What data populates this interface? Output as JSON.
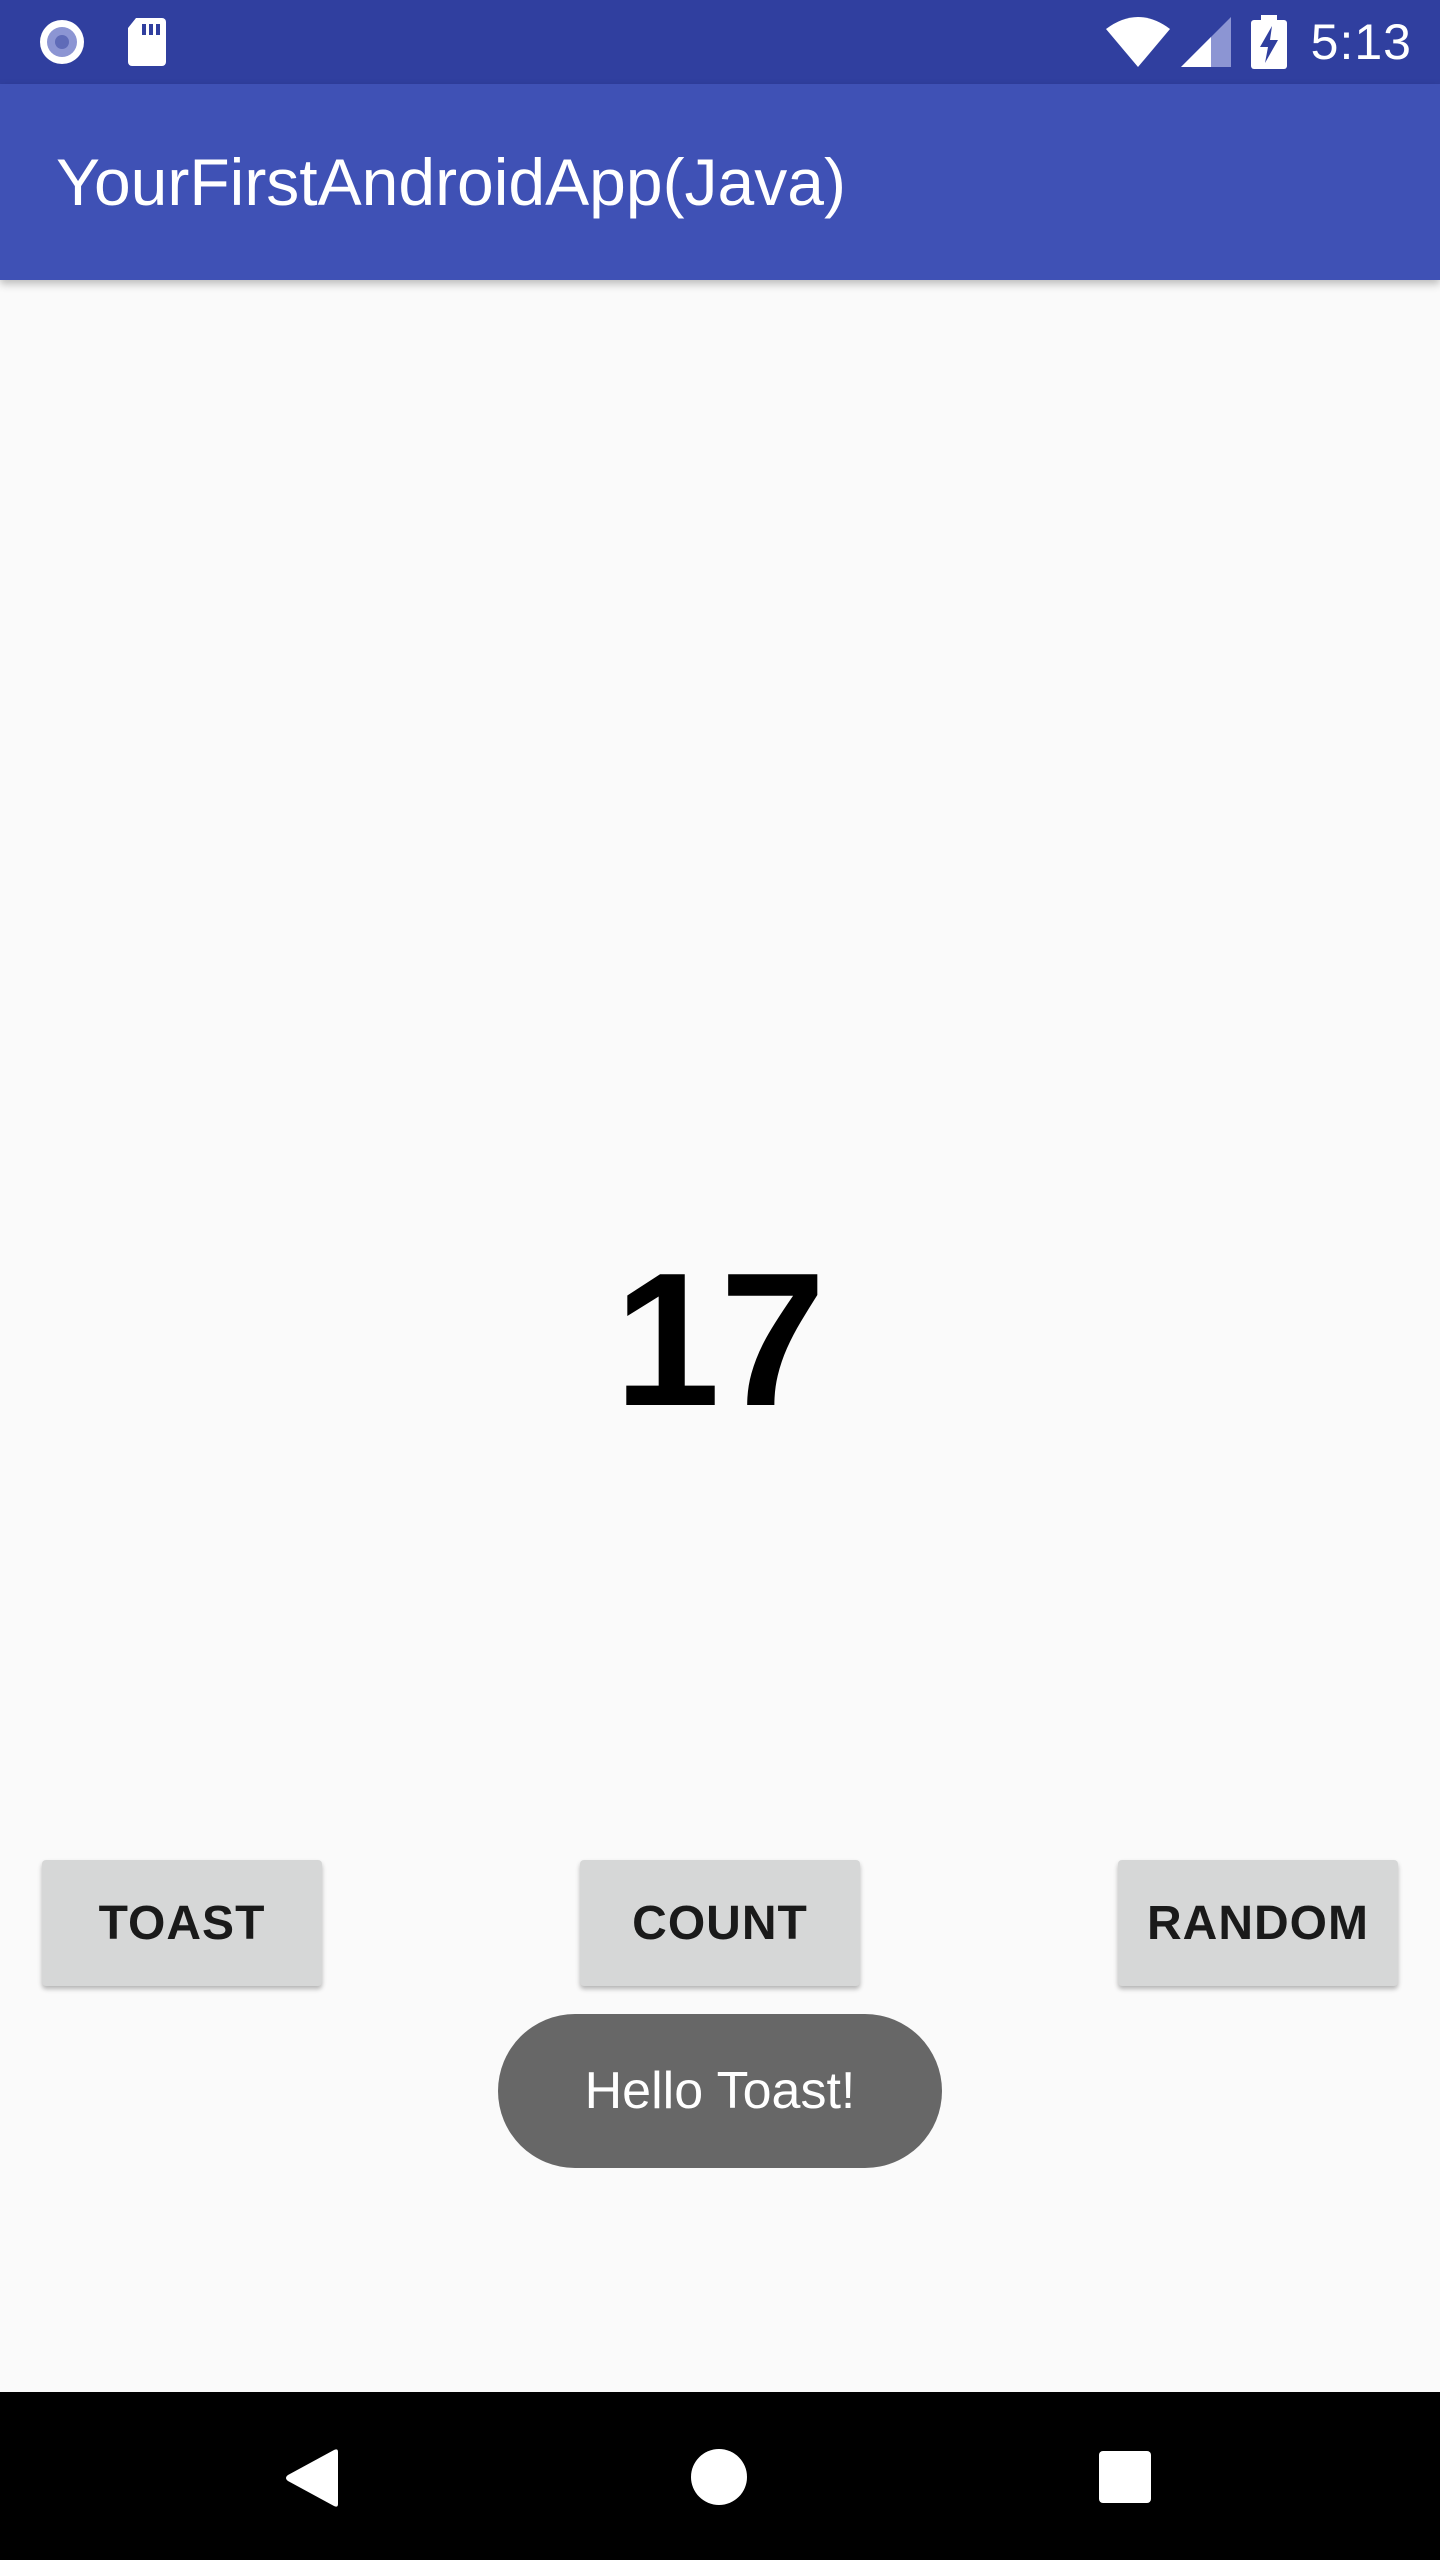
{
  "status_bar": {
    "time": "5:13",
    "left_icons": [
      "record-icon",
      "sd-card-icon"
    ],
    "right_icons": [
      "wifi-icon",
      "cell-signal-icon",
      "battery-charging-icon"
    ],
    "background": "#303f9f"
  },
  "app_bar": {
    "title": "YourFirstAndroidApp(Java)",
    "background": "#3f51b5"
  },
  "main": {
    "count": "17"
  },
  "buttons": {
    "toast_label": "TOAST",
    "count_label": "COUNT",
    "random_label": "RANDOM"
  },
  "toast": {
    "message": "Hello Toast!"
  },
  "nav_bar": {
    "icons": [
      "back-icon",
      "home-icon",
      "recents-icon"
    ]
  }
}
